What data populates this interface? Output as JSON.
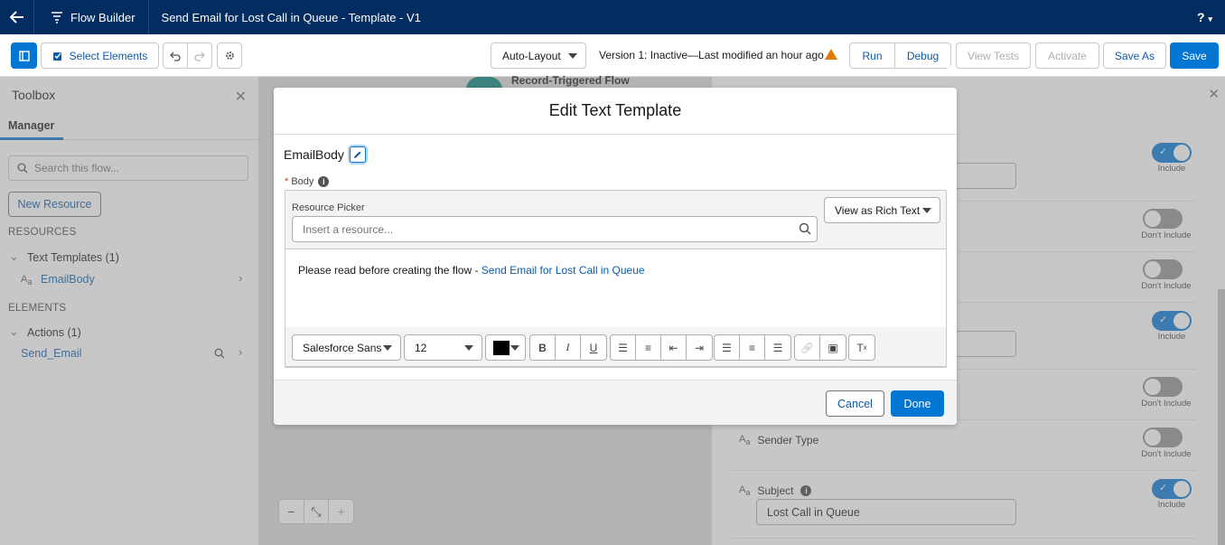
{
  "topbar": {
    "app_name": "Flow Builder",
    "flow_title": "Send Email for Lost Call in Queue - Template - V1",
    "help": "?"
  },
  "toolbar": {
    "select_elements": "Select Elements",
    "auto_layout": "Auto-Layout",
    "version_info": "Version 1: Inactive—Last modified an hour ago",
    "run": "Run",
    "debug": "Debug",
    "view_tests": "View Tests",
    "activate": "Activate",
    "save_as": "Save As",
    "save": "Save"
  },
  "toolbox": {
    "title": "Toolbox",
    "tab": "Manager",
    "search_placeholder": "Search this flow...",
    "new_resource": "New Resource",
    "resources_header": "RESOURCES",
    "text_templates": "Text Templates (1)",
    "email_body": "EmailBody",
    "elements_header": "ELEMENTS",
    "actions": "Actions (1)",
    "send_email": "Send_Email"
  },
  "canvas": {
    "start_label": "Record-Triggered Flow"
  },
  "right_panel": {
    "toggles": [
      {
        "state": "Include"
      },
      {
        "state": "Don't Include"
      },
      {
        "state": "Don't Include"
      },
      {
        "state": "Include"
      },
      {
        "state": "Don't Include"
      },
      {
        "state": "Don't Include"
      },
      {
        "state": "Include"
      }
    ],
    "sender_type_label": "Sender Type",
    "subject_label": "Subject",
    "subject_value": "Lost Call in Queue"
  },
  "modal": {
    "title": "Edit Text Template",
    "api_name": "EmailBody",
    "body_label": "Body",
    "required_mark": "*",
    "resource_picker_label": "Resource Picker",
    "resource_picker_placeholder": "Insert a resource...",
    "view_as": "View as Rich Text",
    "content_text": "Please read before creating the flow - ",
    "content_link": "Send Email for Lost Call in Queue",
    "font_family": "Salesforce Sans",
    "font_size": "12",
    "cancel": "Cancel",
    "done": "Done"
  },
  "colors": {
    "brand_dark": "#032d60",
    "brand": "#0176d3",
    "link": "#0b5cab",
    "warning": "#dd7a01",
    "start_node": "#06817c"
  }
}
